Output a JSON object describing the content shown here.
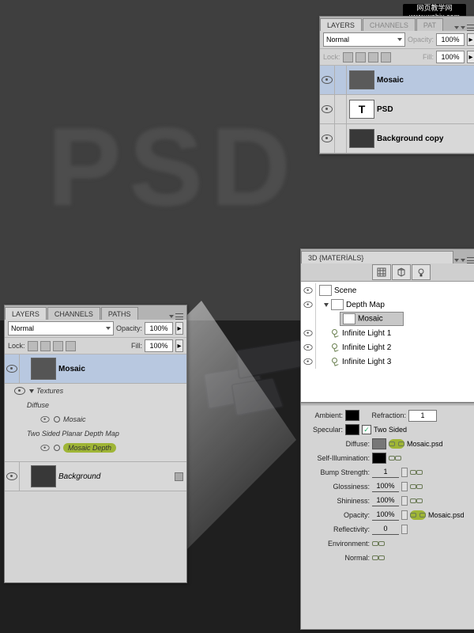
{
  "watermark": {
    "line1": "网页教学网",
    "line2": "www.webjx.com"
  },
  "smallPanel": {
    "tabs": [
      "LAYERS",
      "CHANNELS",
      "PAT"
    ],
    "blendMode": "Normal",
    "opacityLabel": "Opacity:",
    "opacityVal": "100%",
    "lockLabel": "Lock:",
    "fillLabel": "Fill:",
    "fillVal": "100%",
    "layers": [
      {
        "type": "mosaic",
        "name": "Mosaic"
      },
      {
        "type": "text",
        "name": "PSD",
        "glyph": "T"
      },
      {
        "type": "bg",
        "name": "Background copy"
      }
    ]
  },
  "layersPanel": {
    "tabs": [
      "LAYERS",
      "CHANNELS",
      "PATHS"
    ],
    "blendMode": "Normal",
    "opacityLabel": "Opacity:",
    "opacityVal": "100%",
    "lockLabel": "Lock:",
    "fillLabel": "Fill:",
    "fillVal": "100%",
    "rootLayer": "Mosaic",
    "texturesLabel": "Textures",
    "diffuseLabel": "Diffuse",
    "diffuseItem": "Mosaic",
    "depthMapLabel": "Two Sided Planar Depth Map",
    "depthItem": "Mosaic Depth",
    "bgLayer": "Background"
  },
  "materials": {
    "title": "3D {MATERİALS}",
    "scene": "Scene",
    "depthMap": "Depth Map",
    "mosaic": "Mosaic",
    "lights": [
      "Infinite Light 1",
      "Infinite Light 2",
      "Infinite Light 3"
    ],
    "props": {
      "ambient": "Ambient:",
      "refraction": "Refraction:",
      "refractionVal": "1",
      "specular": "Specular:",
      "twoSided": "Two Sided",
      "diffuse": "Diffuse:",
      "diffuseFile": "Mosaic.psd",
      "selfIllum": "Self-Illumination:",
      "bump": "Bump Strength:",
      "bumpVal": "1",
      "gloss": "Glossiness:",
      "glossVal": "100%",
      "shine": "Shininess:",
      "shineVal": "100%",
      "opacity": "Opacity:",
      "opacityVal": "100%",
      "opacityFile": "Mosaic.psd",
      "reflect": "Reflectivity:",
      "reflectVal": "0",
      "env": "Environment:",
      "normal": "Normal:"
    }
  }
}
